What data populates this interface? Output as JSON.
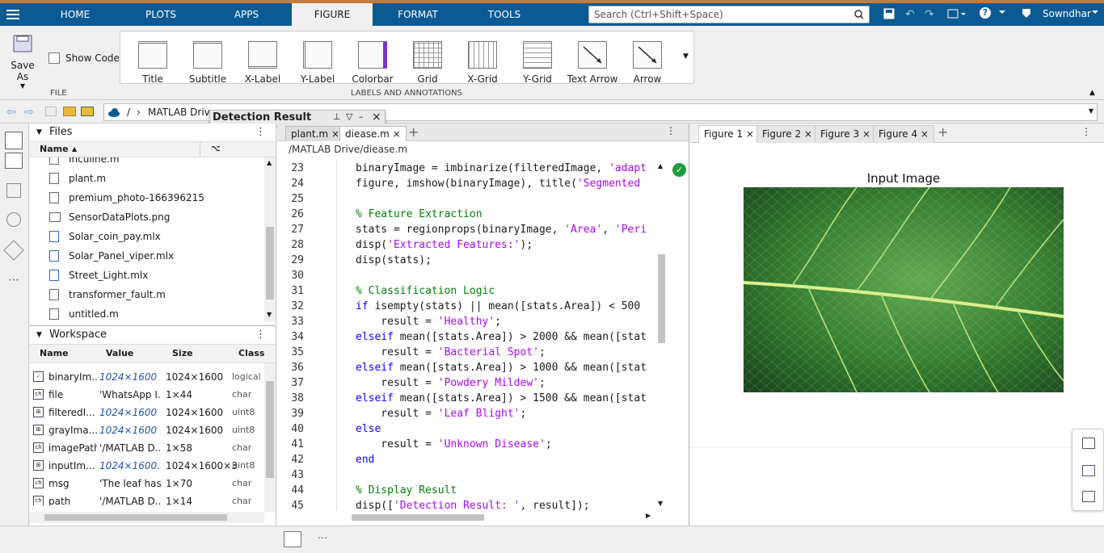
{
  "top_tabs": [
    "HOME",
    "PLOTS",
    "APPS",
    "FIGURE",
    "FORMAT",
    "TOOLS"
  ],
  "search_placeholder": "Search (Ctrl+Shift+Space)",
  "user_name": "Sowndhar",
  "ribbon": {
    "save_as": "Save As",
    "show_code": "Show Code",
    "file_group": "FILE",
    "annotations_group": "LABELS AND ANNOTATIONS",
    "buttons": [
      "Title",
      "Subtitle",
      "X-Label",
      "Y-Label",
      "Colorbar",
      "Grid",
      "X-Grid",
      "Y-Grid",
      "Text Arrow",
      "Arrow"
    ]
  },
  "address": {
    "root": "/",
    "folder": "MATLAB Drive"
  },
  "floating_title": "Detection Result",
  "files_panel": {
    "title": "Files",
    "col_name": "Name",
    "items": [
      "Incuiine.m",
      "plant.m",
      "premium_photo-166396215",
      "SensorDataPlots.png",
      "Solar_coin_pay.mlx",
      "Solar_Panel_viper.mlx",
      "Street_Light.mlx",
      "transformer_fault.m",
      "untitled.m"
    ]
  },
  "workspace": {
    "title": "Workspace",
    "cols": [
      "Name",
      "Value",
      "Size",
      "Class"
    ],
    "rows": [
      {
        "name": "binaryIm...",
        "value": "1024×1600 ...",
        "size": "1024×1600",
        "cls": "logical"
      },
      {
        "name": "file",
        "value": "'WhatsApp I...",
        "size": "1×44",
        "cls": "char"
      },
      {
        "name": "filteredI...",
        "value": "1024×1600 ...",
        "size": "1024×1600",
        "cls": "uint8"
      },
      {
        "name": "grayIma...",
        "value": "1024×1600 ...",
        "size": "1024×1600",
        "cls": "uint8"
      },
      {
        "name": "imagePath",
        "value": "'/MATLAB D...",
        "size": "1×58",
        "cls": "char"
      },
      {
        "name": "inputIm...",
        "value": "1024×1600...",
        "size": "1024×1600×3",
        "cls": "uint8"
      },
      {
        "name": "msg",
        "value": "'The leaf has...",
        "size": "1×70",
        "cls": "char"
      },
      {
        "name": "path",
        "value": "'/MATLAB D...",
        "size": "1×14",
        "cls": "char"
      }
    ]
  },
  "editor": {
    "tabs": [
      "plant.m",
      "diease.m"
    ],
    "path": "/MATLAB Drive/diease.m",
    "lines": [
      {
        "n": "23",
        "html": "binaryImage = imbinarize(filteredImage, <span class=\"st\">'adapt</span>"
      },
      {
        "n": "24",
        "html": "figure, imshow(binaryImage), title(<span class=\"st\">'Segmented</span>"
      },
      {
        "n": "25",
        "html": ""
      },
      {
        "n": "26",
        "html": "<span class=\"cm\">% Feature Extraction</span>"
      },
      {
        "n": "27",
        "html": "stats = regionprops(binaryImage, <span class=\"st\">'Area'</span>, <span class=\"st\">'Peri</span>"
      },
      {
        "n": "28",
        "html": "disp(<span class=\"st\">'Extracted Features:'</span>);"
      },
      {
        "n": "29",
        "html": "disp(stats);"
      },
      {
        "n": "30",
        "html": ""
      },
      {
        "n": "31",
        "html": "<span class=\"cm\">% Classification Logic</span>"
      },
      {
        "n": "32",
        "html": "<span class=\"kw\">if</span> isempty(stats) || mean([stats.Area]) &lt; 500"
      },
      {
        "n": "33",
        "html": "    result = <span class=\"st\">'Healthy'</span>;"
      },
      {
        "n": "34",
        "html": "<span class=\"kw\">elseif</span> mean([stats.Area]) &gt; 2000 &amp;&amp; mean([stat"
      },
      {
        "n": "35",
        "html": "    result = <span class=\"st\">'Bacterial Spot'</span>;"
      },
      {
        "n": "36",
        "html": "<span class=\"kw\">elseif</span> mean([stats.Area]) &gt; 1000 &amp;&amp; mean([stat"
      },
      {
        "n": "37",
        "html": "    result = <span class=\"st\">'Powdery Mildew'</span>;"
      },
      {
        "n": "38",
        "html": "<span class=\"kw\">elseif</span> mean([stats.Area]) &gt; 1500 &amp;&amp; mean([stat"
      },
      {
        "n": "39",
        "html": "    result = <span class=\"st\">'Leaf Blight'</span>;"
      },
      {
        "n": "40",
        "html": "<span class=\"kw\">else</span>"
      },
      {
        "n": "41",
        "html": "    result = <span class=\"st\">'Unknown Disease'</span>;"
      },
      {
        "n": "42",
        "html": "<span class=\"kw\">end</span>"
      },
      {
        "n": "43",
        "html": ""
      },
      {
        "n": "44",
        "html": "<span class=\"cm\">% Display Result</span>"
      },
      {
        "n": "45",
        "html": "disp([<span class=\"st\">'Detection Result: '</span>, result]);"
      }
    ]
  },
  "figure": {
    "tabs": [
      "Figure 1",
      "Figure 2",
      "Figure 3",
      "Figure 4"
    ],
    "axes_title": "Input Image"
  },
  "colors": {
    "accent": "#0b5a94",
    "keyword": "#0e00ff",
    "string": "#a709f5",
    "comment": "#028009"
  }
}
